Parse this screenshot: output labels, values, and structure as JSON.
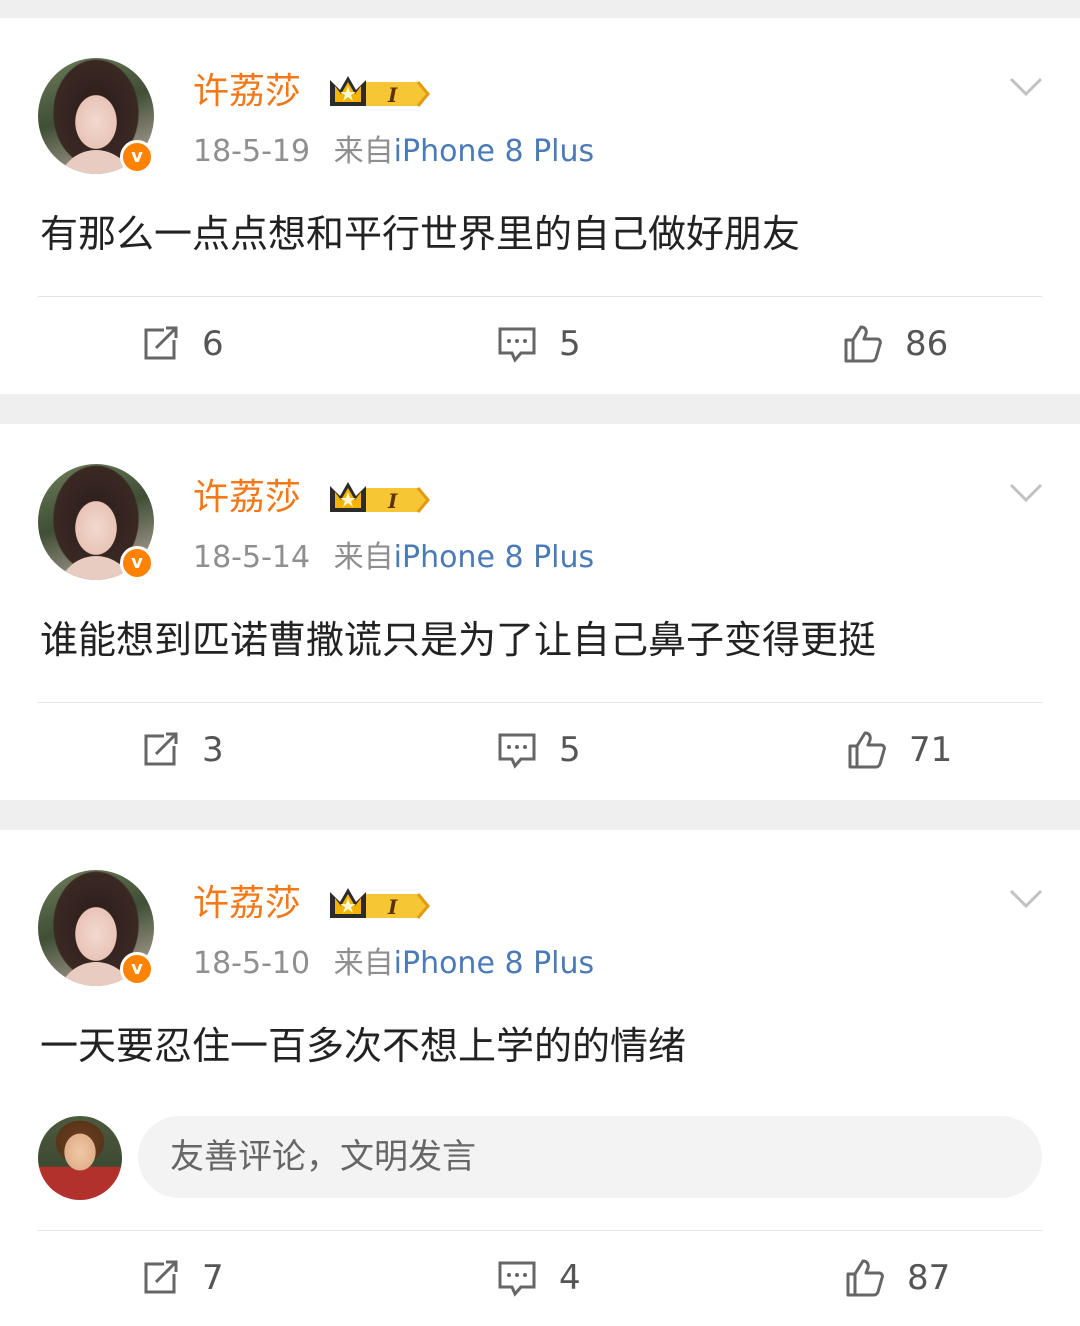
{
  "posts": [
    {
      "username": "许荔莎",
      "crown_level": "I",
      "date": "18-5-19",
      "source_prefix": "来自",
      "device": "iPhone 8 Plus",
      "text": "有那么一点点想和平行世界里的自己做好朋友",
      "reposts": "6",
      "comments": "5",
      "likes": "86"
    },
    {
      "username": "许荔莎",
      "crown_level": "I",
      "date": "18-5-14",
      "source_prefix": "来自",
      "device": "iPhone 8 Plus",
      "text": "谁能想到匹诺曹撒谎只是为了让自己鼻子变得更挺",
      "reposts": "3",
      "comments": "5",
      "likes": "71"
    },
    {
      "username": "许荔莎",
      "crown_level": "I",
      "date": "18-5-10",
      "source_prefix": "来自",
      "device": "iPhone 8 Plus",
      "text": "一天要忍住一百多次不想上学的的情绪",
      "comment_placeholder": "友善评论，文明发言",
      "reposts": "7",
      "comments": "4",
      "likes": "87"
    }
  ],
  "icons": {
    "repost": "repost-icon",
    "comment": "comment-icon",
    "like": "thumbs-up-icon",
    "menu": "chevron-down-icon",
    "verified": "verified-badge-icon",
    "crown": "crown-level-icon"
  },
  "colors": {
    "username": "#f2781a",
    "device": "#4a7ab7",
    "meta": "#8f8f8f",
    "verified": "#ff8200"
  }
}
